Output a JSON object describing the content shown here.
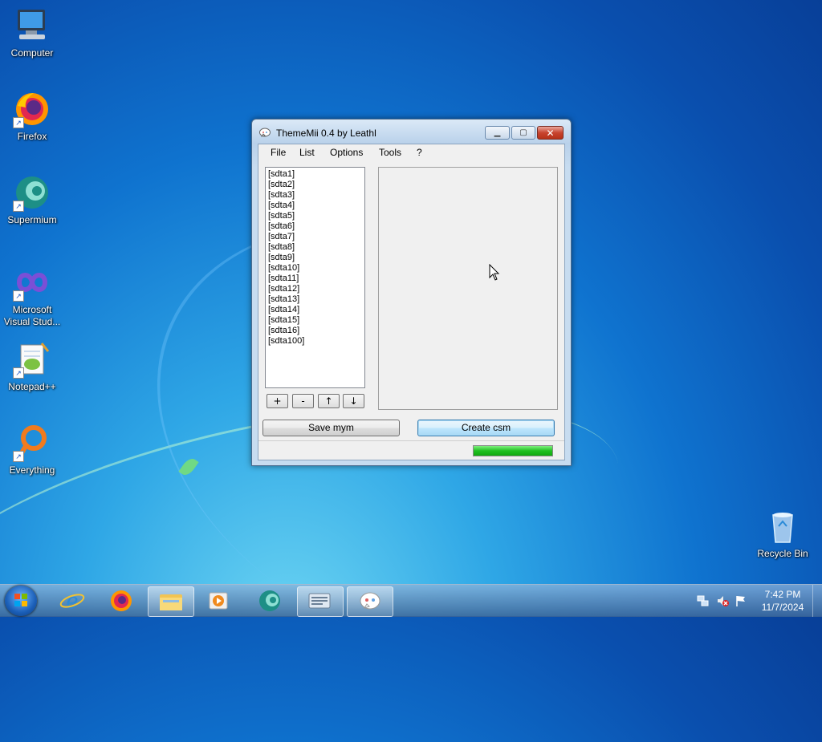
{
  "desktop": {
    "icons": [
      {
        "label": "Computer"
      },
      {
        "label": "Firefox"
      },
      {
        "label": "Supermium"
      },
      {
        "label": "Microsoft Visual Stud..."
      },
      {
        "label": "Notepad++"
      },
      {
        "label": "Everything"
      },
      {
        "label": "Recycle Bin"
      }
    ]
  },
  "window": {
    "title": "ThemeMii 0.4 by Leathl",
    "menu": [
      "File",
      "List",
      "Options",
      "Tools",
      "?"
    ],
    "list_items": [
      "[sdta1]",
      "[sdta2]",
      "[sdta3]",
      "[sdta4]",
      "[sdta5]",
      "[sdta6]",
      "[sdta7]",
      "[sdta8]",
      "[sdta9]",
      "[sdta10]",
      "[sdta11]",
      "[sdta12]",
      "[sdta13]",
      "[sdta14]",
      "[sdta15]",
      "[sdta16]",
      "[sdta100]"
    ],
    "small_buttons": [
      "+",
      "-",
      "↑",
      "↓"
    ],
    "save_button": "Save mym",
    "create_button": "Create csm",
    "progress": 1.0
  },
  "taskbar": {
    "clock_time": "7:42 PM",
    "clock_date": "11/7/2024",
    "items": [
      "internet-explorer",
      "firefox",
      "file-explorer",
      "media-player",
      "supermium",
      "on-screen-keyboard",
      "thememii"
    ]
  },
  "colors": {
    "accent": "#0f73cf",
    "progress": "#20c020"
  }
}
